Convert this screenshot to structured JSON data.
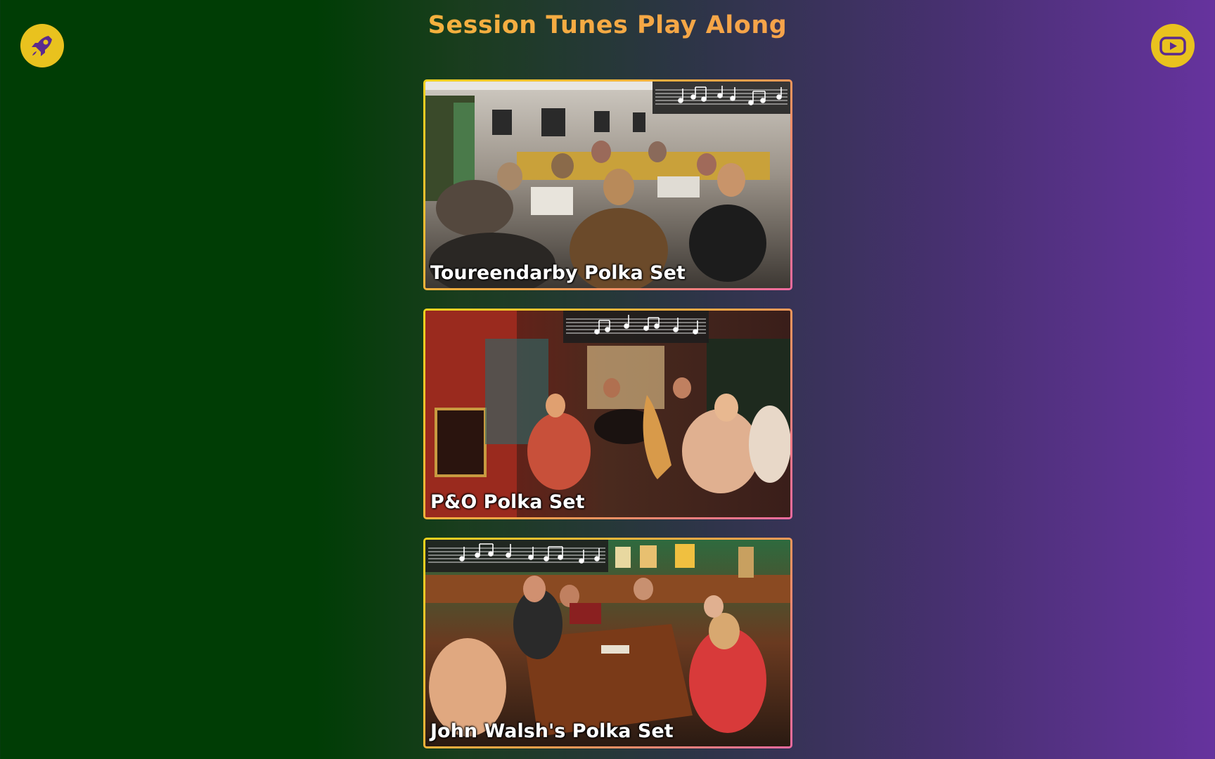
{
  "header": {
    "title": "Session Tunes Play Along"
  },
  "nav": {
    "home_icon": "rocket-icon",
    "youtube_icon": "youtube-icon"
  },
  "videos": [
    {
      "title": "Toureendarby Polka Set",
      "scene": "cafe-session-warm"
    },
    {
      "title": "P&O Polka Set",
      "scene": "pub-session-red"
    },
    {
      "title": "John Walsh's Polka Set",
      "scene": "pub-session-green"
    }
  ],
  "colors": {
    "accent": "#e9c21e",
    "title_gradient_start": "#f2c230",
    "title_gradient_end": "#f08a6a",
    "background_left": "#003d05",
    "background_right": "#66339e",
    "card_border_start": "#f2d21e",
    "card_border_end": "#ef6aa0"
  }
}
